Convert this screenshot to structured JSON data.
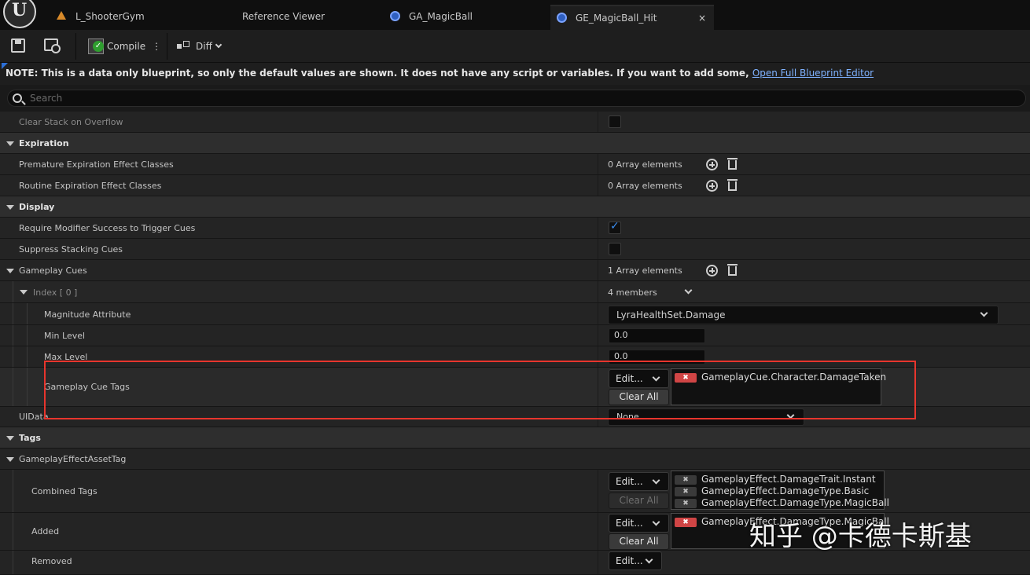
{
  "tabs": [
    {
      "label": "L_ShooterGym",
      "icon": "level-icon"
    },
    {
      "label": "Reference Viewer",
      "icon": ""
    },
    {
      "label": "GA_MagicBall",
      "icon": "blueprint-icon"
    },
    {
      "label": "GE_MagicBall_Hit",
      "icon": "blueprint-icon",
      "active": true,
      "close": "×"
    }
  ],
  "logo": "U",
  "toolbar": {
    "compile_label": "Compile",
    "more_label": "⋮",
    "diff_label": "Diff"
  },
  "notice": {
    "text": "NOTE: This is a data only blueprint, so only the default values are shown.  It does not have any script or variables.  If you want to add some, ",
    "link": "Open Full Blueprint Editor"
  },
  "search": {
    "placeholder": "Search"
  },
  "rows": {
    "clear_stack": {
      "label": "Clear Stack on Overflow",
      "checked": false
    },
    "expiration": {
      "label": "Expiration"
    },
    "premature": {
      "label": "Premature Expiration Effect Classes",
      "value": "0 Array elements"
    },
    "routine": {
      "label": "Routine Expiration Effect Classes",
      "value": "0 Array elements"
    },
    "display": {
      "label": "Display"
    },
    "require_mod": {
      "label": "Require Modifier Success to Trigger Cues",
      "checked": true
    },
    "suppress": {
      "label": "Suppress Stacking Cues",
      "checked": false
    },
    "gameplay_cues": {
      "label": "Gameplay Cues",
      "value": "1 Array elements"
    },
    "index0": {
      "label": "Index [ 0 ]",
      "value": "4 members"
    },
    "magnitude": {
      "label": "Magnitude Attribute",
      "value": "LyraHealthSet.Damage"
    },
    "min_level": {
      "label": "Min Level",
      "value": "0.0"
    },
    "max_level": {
      "label": "Max Level",
      "value": "0.0"
    },
    "cue_tags": {
      "label": "Gameplay Cue Tags",
      "edit": "Edit...",
      "clear": "Clear All",
      "tags": [
        "GameplayCue.Character.DamageTaken"
      ]
    },
    "uidata": {
      "label": "UIData",
      "value": "None"
    },
    "tags": {
      "label": "Tags"
    },
    "asset_tag": {
      "label": "GameplayEffectAssetTag"
    },
    "combined": {
      "label": "Combined Tags",
      "edit": "Edit...",
      "clear": "Clear All",
      "tags": [
        "GameplayEffect.DamageTrait.Instant",
        "GameplayEffect.DamageType.Basic",
        "GameplayEffect.DamageType.MagicBall"
      ]
    },
    "added": {
      "label": "Added",
      "edit": "Edit...",
      "clear": "Clear All",
      "tags": [
        "GameplayEffect.DamageType.MagicBall"
      ]
    },
    "removed": {
      "label": "Removed",
      "edit": "Edit..."
    }
  },
  "watermark": "知乎 @卡德卡斯基",
  "colors": {
    "highlight": "#e8352d",
    "accent": "#3b8df0",
    "tag_remove": "#d04545"
  }
}
